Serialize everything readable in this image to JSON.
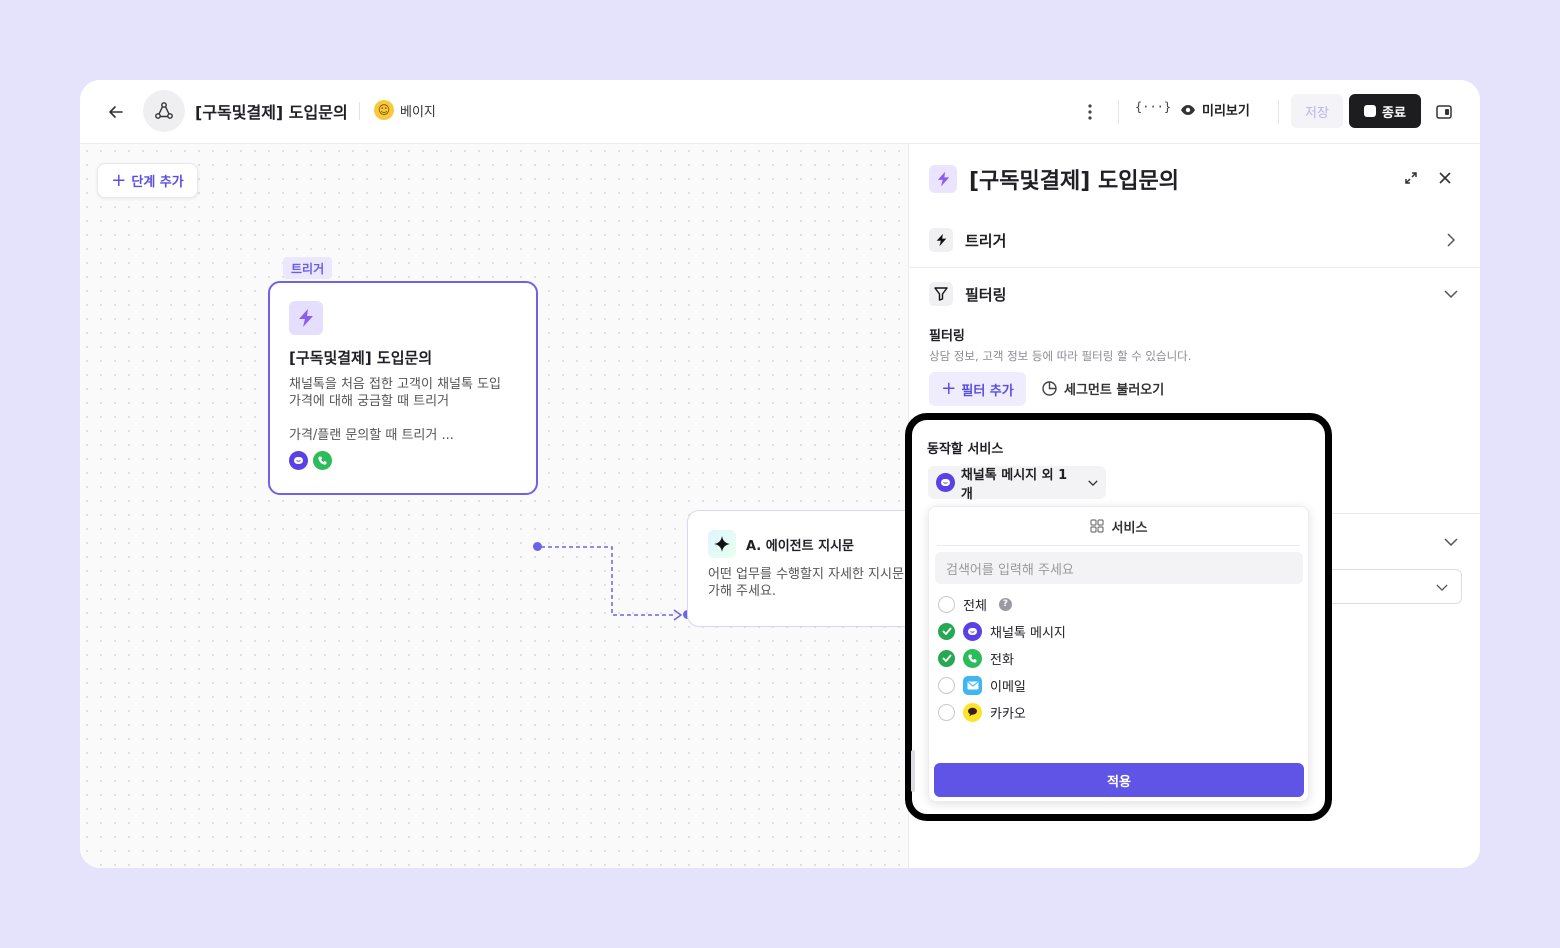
{
  "topbar": {
    "title": "[구독및결제] 도입문의",
    "owner": "베이지",
    "variables_label": "{···}",
    "preview_label": "미리보기",
    "save_label": "저장",
    "end_label": "종료"
  },
  "canvas": {
    "add_step_label": "단계 추가",
    "trigger_tag": "트리거",
    "trigger_card": {
      "title": "[구독및결제] 도입문의",
      "description": "채널톡을 처음 접한 고객이 채널톡 도입\n가격에 대해 궁금할 때 트리거",
      "condition": "가격/플랜 문의할 때 트리거 ..."
    },
    "agent_card": {
      "title": "A. 에이전트 지시문",
      "description": "어떤 업무를 수행할지 자세한 지시문\n가해 주세요."
    }
  },
  "panel": {
    "title": "[구독및결제] 도입문의",
    "sections": {
      "trigger": "트리거",
      "filtering": "필터링"
    },
    "filter": {
      "label": "필터링",
      "help": "상담 정보, 고객 정보 등에 따라 필터링 할 수 있습니다.",
      "add_label": "필터 추가",
      "segment_label": "세그먼트 불러오기"
    },
    "service": {
      "label": "동작할 서비스",
      "selected": "채널톡 메시지 외 1개"
    }
  },
  "dropdown": {
    "header": "서비스",
    "search_placeholder": "검색어를 입력해 주세요",
    "items": [
      {
        "label": "전체",
        "checked": false
      },
      {
        "label": "채널톡 메시지",
        "checked": true
      },
      {
        "label": "전화",
        "checked": true
      },
      {
        "label": "이메일",
        "checked": false
      },
      {
        "label": "카카오",
        "checked": false
      }
    ],
    "apply_label": "적용"
  },
  "colors": {
    "accent": "#5f54e6",
    "check": "#27a954",
    "background": "#e4e3fb"
  }
}
